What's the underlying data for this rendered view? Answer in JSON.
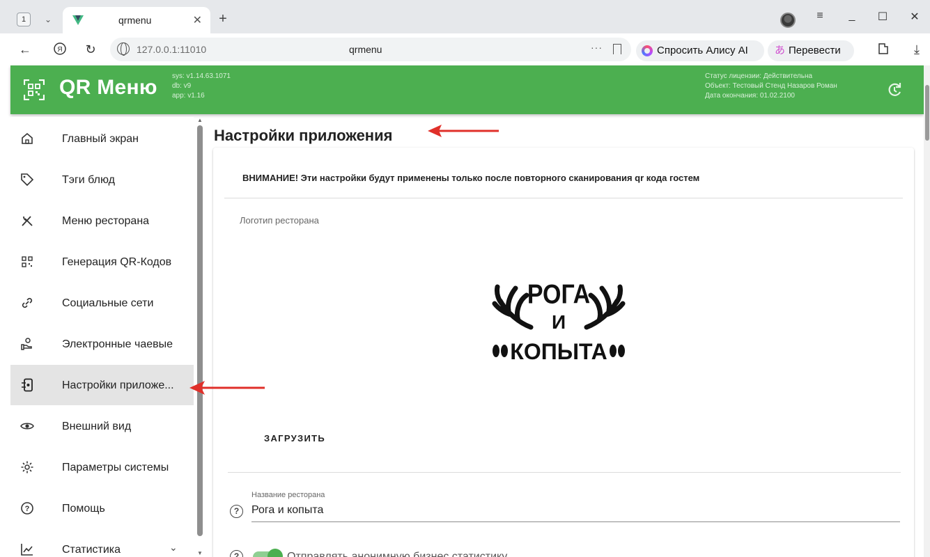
{
  "browser": {
    "tab_count": "1",
    "tab_title": "qrmenu",
    "address_url": "127.0.0.1:11010",
    "address_title": "qrmenu",
    "alice_button": "Спросить Алису AI",
    "translate_button": "Перевести"
  },
  "header": {
    "app_name": "QR Меню",
    "versions": [
      "sys: v1.14.63.1071",
      "db: v9",
      "app: v1.16"
    ],
    "license": [
      "Статус лицензии: Действительна",
      "Объект: Тестовый Стенд Назаров Роман",
      "Дата окончания: 01.02.2100"
    ],
    "brand_color": "#4caf50"
  },
  "sidebar": {
    "items": [
      {
        "label": "Главный экран",
        "icon": "home-icon"
      },
      {
        "label": "Тэги блюд",
        "icon": "tag-icon"
      },
      {
        "label": "Меню ресторана",
        "icon": "cutlery-icon"
      },
      {
        "label": "Генерация QR-Кодов",
        "icon": "qr-code-icon"
      },
      {
        "label": "Социальные сети",
        "icon": "link-icon"
      },
      {
        "label": "Электронные чаевые",
        "icon": "tip-hand-icon"
      },
      {
        "label": "Настройки приложе...",
        "icon": "app-settings-icon",
        "active": true
      },
      {
        "label": "Внешний вид",
        "icon": "eye-icon"
      },
      {
        "label": "Параметры системы",
        "icon": "gear-icon"
      },
      {
        "label": "Помощь",
        "icon": "help-icon"
      },
      {
        "label": "Статистика",
        "icon": "chart-icon",
        "expandable": true
      }
    ]
  },
  "main": {
    "page_title": "Настройки приложения",
    "warning": "ВНИМАНИЕ! Эти настройки будут применены только после повторного сканирования qr кода гостем",
    "logo_caption": "Логотип ресторана",
    "logo_text": [
      "РОГА",
      "И",
      "КОПЫТА"
    ],
    "upload_button": "ЗАГРУЗИТЬ",
    "restaurant_name_label": "Название ресторана",
    "restaurant_name_value": "Рога и копыта",
    "anon_stats_label": "Отправлять анонимную бизнес статистику",
    "anon_stats_enabled": true
  },
  "annotations": {
    "arrow_color": "#e0302a"
  }
}
